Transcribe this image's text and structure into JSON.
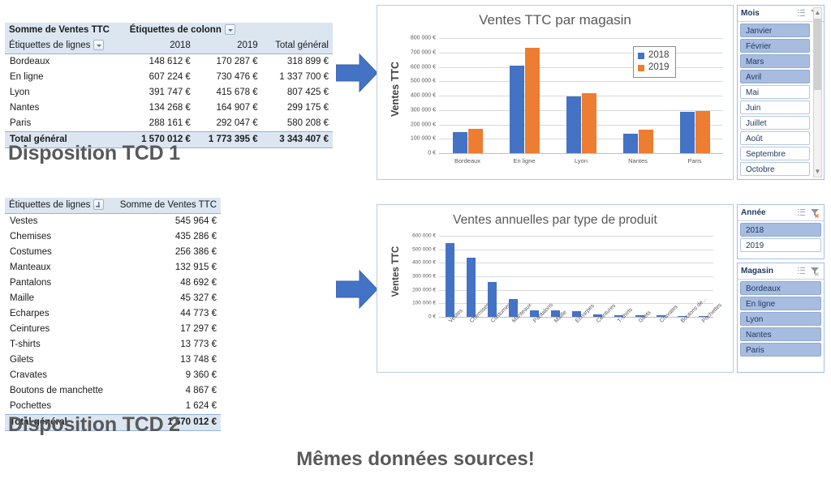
{
  "captions": {
    "tcd1": "Disposition TCD 1",
    "tcd2": "Disposition TCD 2",
    "footnote": "Mêmes données sources!"
  },
  "pivot1": {
    "value_field_label": "Somme de Ventes TTC",
    "column_labels_label": "Étiquettes de colonn",
    "row_labels_label": "Étiquettes de lignes",
    "columns": [
      "2018",
      "2019",
      "Total général"
    ],
    "rows": [
      {
        "label": "Bordeaux",
        "values": [
          "148 612 €",
          "170 287 €",
          "318 899 €"
        ]
      },
      {
        "label": "En ligne",
        "values": [
          "607 224 €",
          "730 476 €",
          "1 337 700 €"
        ]
      },
      {
        "label": "Lyon",
        "values": [
          "391 747 €",
          "415 678 €",
          "807 425 €"
        ]
      },
      {
        "label": "Nantes",
        "values": [
          "134 268 €",
          "164 907 €",
          "299 175 €"
        ]
      },
      {
        "label": "Paris",
        "values": [
          "288 161 €",
          "292 047 €",
          "580 208 €"
        ]
      }
    ],
    "total": {
      "label": "Total général",
      "values": [
        "1 570 012 €",
        "1 773 395 €",
        "3 343 407 €"
      ]
    }
  },
  "pivot2": {
    "row_labels_label": "Étiquettes de lignes",
    "value_field_label": "Somme de Ventes TTC",
    "rows": [
      {
        "label": "Vestes",
        "value": "545 964 €"
      },
      {
        "label": "Chemises",
        "value": "435 286 €"
      },
      {
        "label": "Costumes",
        "value": "256 386 €"
      },
      {
        "label": "Manteaux",
        "value": "132 915 €"
      },
      {
        "label": "Pantalons",
        "value": "48 692 €"
      },
      {
        "label": "Maille",
        "value": "45 327 €"
      },
      {
        "label": "Echarpes",
        "value": "44 773 €"
      },
      {
        "label": "Ceintures",
        "value": "17 297 €"
      },
      {
        "label": "T-shirts",
        "value": "13 773 €"
      },
      {
        "label": "Gilets",
        "value": "13 748 €"
      },
      {
        "label": "Cravates",
        "value": "9 360 €"
      },
      {
        "label": "Boutons de manchette",
        "value": "4 867 €"
      },
      {
        "label": "Pochettes",
        "value": "1 624 €"
      }
    ],
    "total": {
      "label": "Total général",
      "value": "1 570 012 €"
    }
  },
  "chart_data": [
    {
      "type": "bar",
      "title": "Ventes TTC par magasin",
      "xlabel": "",
      "ylabel": "Ventes TTC",
      "categories": [
        "Bordeaux",
        "En ligne",
        "Lyon",
        "Nantes",
        "Paris"
      ],
      "series": [
        {
          "name": "2018",
          "color": "#4472c4",
          "values": [
            148612,
            607224,
            391747,
            134268,
            288161
          ]
        },
        {
          "name": "2019",
          "color": "#ed7d31",
          "values": [
            170287,
            730476,
            415678,
            164907,
            292047
          ]
        }
      ],
      "ylim": [
        0,
        800000
      ],
      "yticks": [
        0,
        100000,
        200000,
        300000,
        400000,
        500000,
        600000,
        700000,
        800000
      ],
      "ytick_labels": [
        "0 €",
        "100 000 €",
        "200 000 €",
        "300 000 €",
        "400 000 €",
        "500 000 €",
        "600 000 €",
        "700 000 €",
        "800 000 €"
      ],
      "grid": true,
      "legend_position": "top-right",
      "legend": [
        "2018",
        "2019"
      ]
    },
    {
      "type": "bar",
      "title": "Ventes annuelles par type de produit",
      "xlabel": "",
      "ylabel": "Ventes TTC",
      "categories": [
        "Vestes",
        "Chemises",
        "Costumes",
        "Manteaux",
        "Pantalons",
        "Maille",
        "Echarpes",
        "Ceintures",
        "T-shirts",
        "Gilets",
        "Cravates",
        "Boutons de...",
        "Pochettes"
      ],
      "series": [
        {
          "name": "Ventes TTC",
          "color": "#4472c4",
          "values": [
            545964,
            435286,
            256386,
            132915,
            48692,
            45327,
            44773,
            17297,
            13773,
            13748,
            9360,
            4867,
            1624
          ]
        }
      ],
      "ylim": [
        0,
        600000
      ],
      "yticks": [
        0,
        100000,
        200000,
        300000,
        400000,
        500000,
        600000
      ],
      "ytick_labels": [
        "0 €",
        "100 000 €",
        "200 000 €",
        "300 000 €",
        "400 000 €",
        "500 000 €",
        "600 000 €"
      ],
      "grid": true,
      "legend_position": "none",
      "legend": []
    }
  ],
  "slicers": [
    {
      "title": "Mois",
      "items": [
        {
          "label": "Janvier",
          "selected": true
        },
        {
          "label": "Février",
          "selected": true
        },
        {
          "label": "Mars",
          "selected": true
        },
        {
          "label": "Avril",
          "selected": true
        },
        {
          "label": "Mai",
          "selected": false
        },
        {
          "label": "Juin",
          "selected": false
        },
        {
          "label": "Juillet",
          "selected": false
        },
        {
          "label": "Août",
          "selected": false
        },
        {
          "label": "Septembre",
          "selected": false
        },
        {
          "label": "Octobre",
          "selected": false
        }
      ],
      "scrollbar": true
    },
    {
      "title": "Année",
      "items": [
        {
          "label": "2018",
          "selected": true
        },
        {
          "label": "2019",
          "selected": false
        }
      ],
      "scrollbar": false
    },
    {
      "title": "Magasin",
      "items": [
        {
          "label": "Bordeaux",
          "selected": true
        },
        {
          "label": "En ligne",
          "selected": true
        },
        {
          "label": "Lyon",
          "selected": true
        },
        {
          "label": "Nantes",
          "selected": true
        },
        {
          "label": "Paris",
          "selected": true
        }
      ],
      "scrollbar": false
    }
  ],
  "colors": {
    "series_2018": "#4472c4",
    "series_2019": "#ed7d31",
    "arrow": "#4472c4",
    "pivot_header": "#dce6f1",
    "slicer_selected": "#a8bcdf"
  }
}
